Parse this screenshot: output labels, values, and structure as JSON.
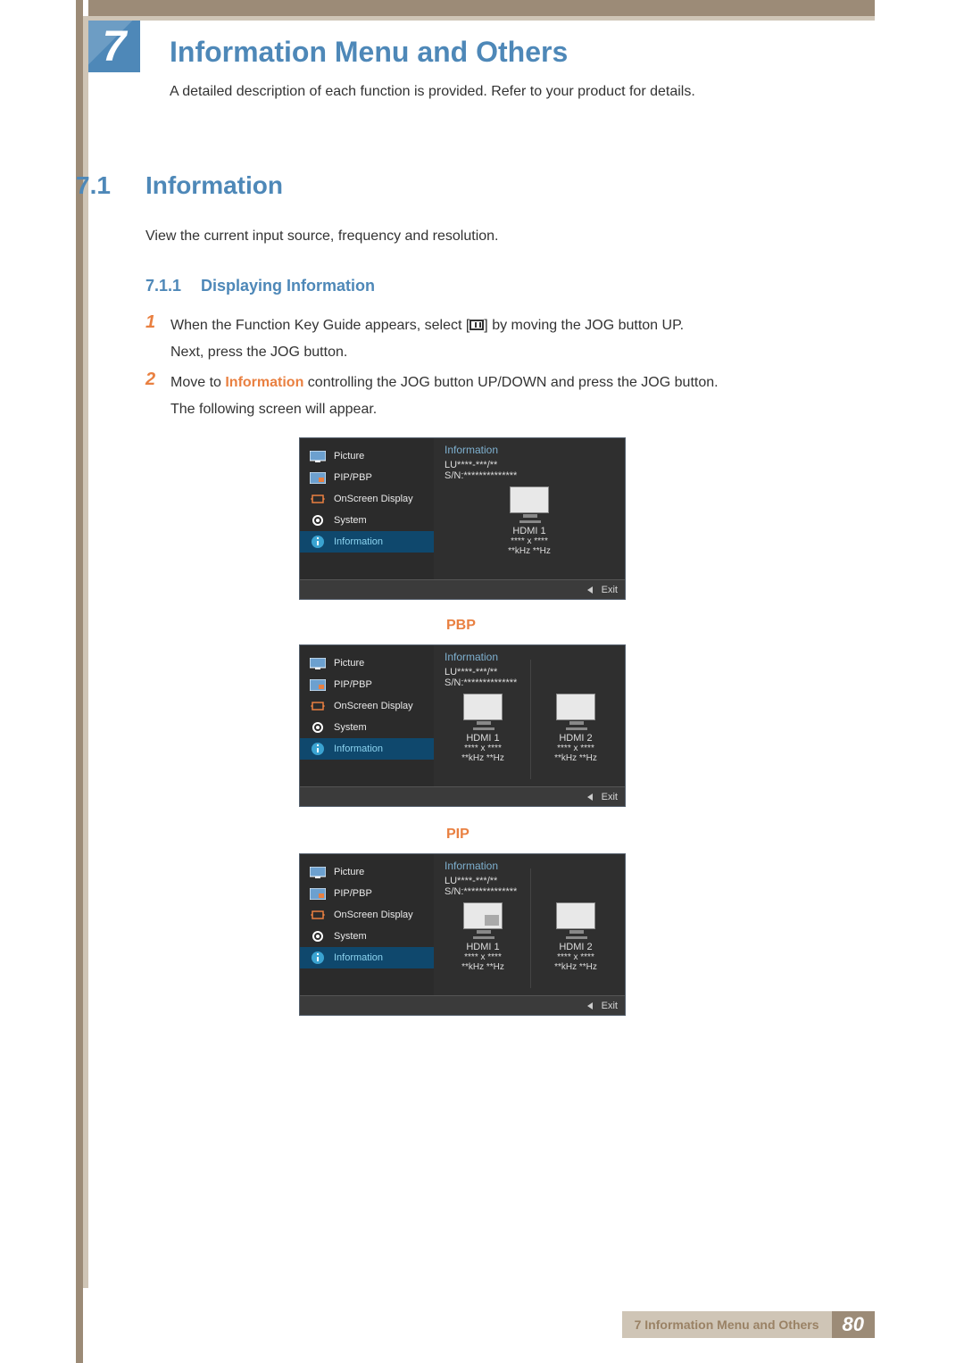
{
  "chapter": {
    "number": "7",
    "title": "Information Menu and Others",
    "subtitle": "A detailed description of each function is provided. Refer to your product for details."
  },
  "section": {
    "number": "7.1",
    "title": "Information",
    "desc": "View the current input source, frequency and resolution."
  },
  "subsection": {
    "number": "7.1.1",
    "title": "Displaying Information"
  },
  "steps": {
    "s1": {
      "num": "1",
      "line1a": "When the Function Key Guide appears, select [",
      "line1b": "] by moving the JOG button UP.",
      "line2": "Next, press the JOG button."
    },
    "s2": {
      "num": "2",
      "line1a": "Move to ",
      "highlight": "Information",
      "line1b": " controlling the JOG button UP/DOWN and press the JOG button.",
      "line2": "The following screen will appear."
    }
  },
  "osd": {
    "menu": {
      "picture": "Picture",
      "pippbp": "PIP/PBP",
      "onscreen": "OnScreen Display",
      "system": "System",
      "information": "Information"
    },
    "info": {
      "title": "Information",
      "model": "LU****-***/**",
      "sn": "S/N:**************"
    },
    "source": {
      "hdmi1": {
        "name": "HDMI 1",
        "res": "**** x ****",
        "freq": "**kHz **Hz"
      },
      "hdmi2": {
        "name": "HDMI 2",
        "res": "**** x ****",
        "freq": "**kHz **Hz"
      }
    },
    "labels": {
      "pbp": "PBP",
      "pip": "PIP"
    },
    "footer": {
      "exit": "Exit"
    }
  },
  "footer": {
    "text": "7 Information Menu and Others",
    "page": "80"
  }
}
